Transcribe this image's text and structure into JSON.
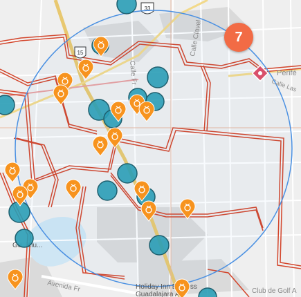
{
  "map": {
    "street_labels": {
      "calle_clavel": "Calle Clavel",
      "calle_fr": "Calle Fr",
      "periferico": "Perifé",
      "calle_las": "Calle Las",
      "avenida": "Avenida Fr",
      "gl_jalisco": "Gu...elu...",
      "club_golf": "Club de Golf A",
      "holiday_inn_1": "Holiday Inn Express",
      "holiday_inn_2": "Guadalajara A"
    },
    "highway_shield": "33",
    "highway_shield_2": "15",
    "cluster": {
      "count": "7",
      "color": "#f26b45"
    },
    "colors": {
      "orange_marker": "#f7931e",
      "teal_marker": "#2a9db6",
      "boundary": "#d3452b",
      "radius_circle": "#4a90e2",
      "pink_marker": "#d9506b"
    },
    "icons": {
      "orange_marker": "money-bag-pin-icon",
      "teal_marker": "circle-location-icon",
      "pink_marker": "special-location-pin-icon"
    }
  }
}
